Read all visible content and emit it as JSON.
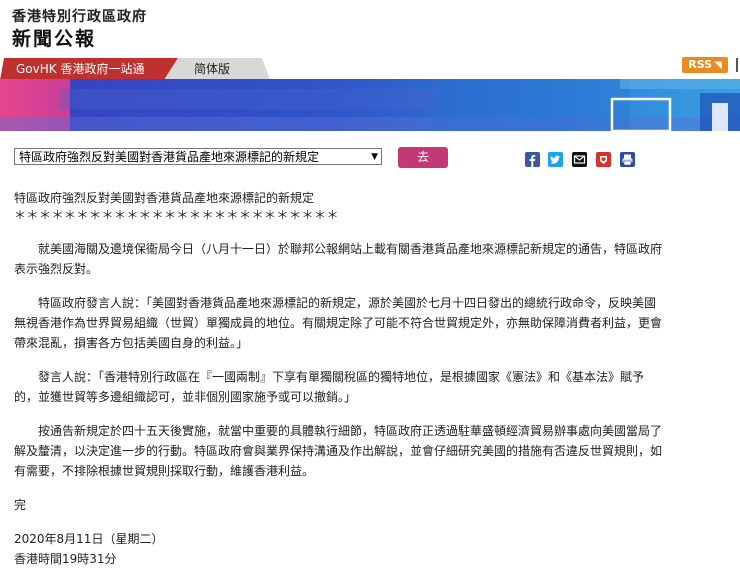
{
  "header": {
    "gov_name": "香港特別行政區政府",
    "press_title": "新聞公報"
  },
  "nav": {
    "govhk": "GovHK 香港政府一站通",
    "simplified": "简体版",
    "rss": "RSS"
  },
  "toolbar": {
    "selected_topic": "特區政府強烈反對美國對香港貨品產地來源標記的新規定",
    "go_label": "去"
  },
  "article": {
    "title": "特區政府強烈反對美國對香港貨品產地來源標記的新規定",
    "stars": "＊＊＊＊＊＊＊＊＊＊＊＊＊＊＊＊＊＊＊＊＊＊＊＊＊＊",
    "paragraphs": [
      "就美國海關及邊境保衞局今日（八月十一日）於聯邦公報網站上載有關香港貨品產地來源標記新規定的通告，特區政府表示強烈反對。",
      "特區政府發言人說：「美國對香港貨品產地來源標記的新規定，源於美國於七月十四日發出的總統行政命令，反映美國無視香港作為世界貿易組織（世貿）單獨成員的地位。有關規定除了可能不符合世貿規定外，亦無助保障消費者利益，更會帶來混亂，損害各方包括美國自身的利益。」",
      "發言人說：「香港特別行政區在『一國兩制』下享有單獨關稅區的獨特地位，是根據國家《憲法》和《基本法》賦予的，並獲世貿等多邊組織認可，並非個別國家施予或可以撤銷。」",
      "按通告新規定於四十五天後實施，就當中重要的具體執行細節，特區政府正透過駐華盛頓經濟貿易辦事處向美國當局了解及釐清，以決定進一步的行動。特區政府會與業界保持溝通及作出解說，並會仔細研究美國的措施有否違反世貿規則，如有需要，不排除根據世貿規則採取行動，維護香港利益。"
    ],
    "end_mark": "完",
    "date": "2020年8月11日（星期二）",
    "time": "香港時間19時31分"
  },
  "colors": {
    "nav_red": "#c0302f",
    "nav_grey": "#d8d8d8",
    "banner_blue": "#2a4fbf",
    "go_button": "#c53876",
    "rss_orange": "#e98a23"
  }
}
